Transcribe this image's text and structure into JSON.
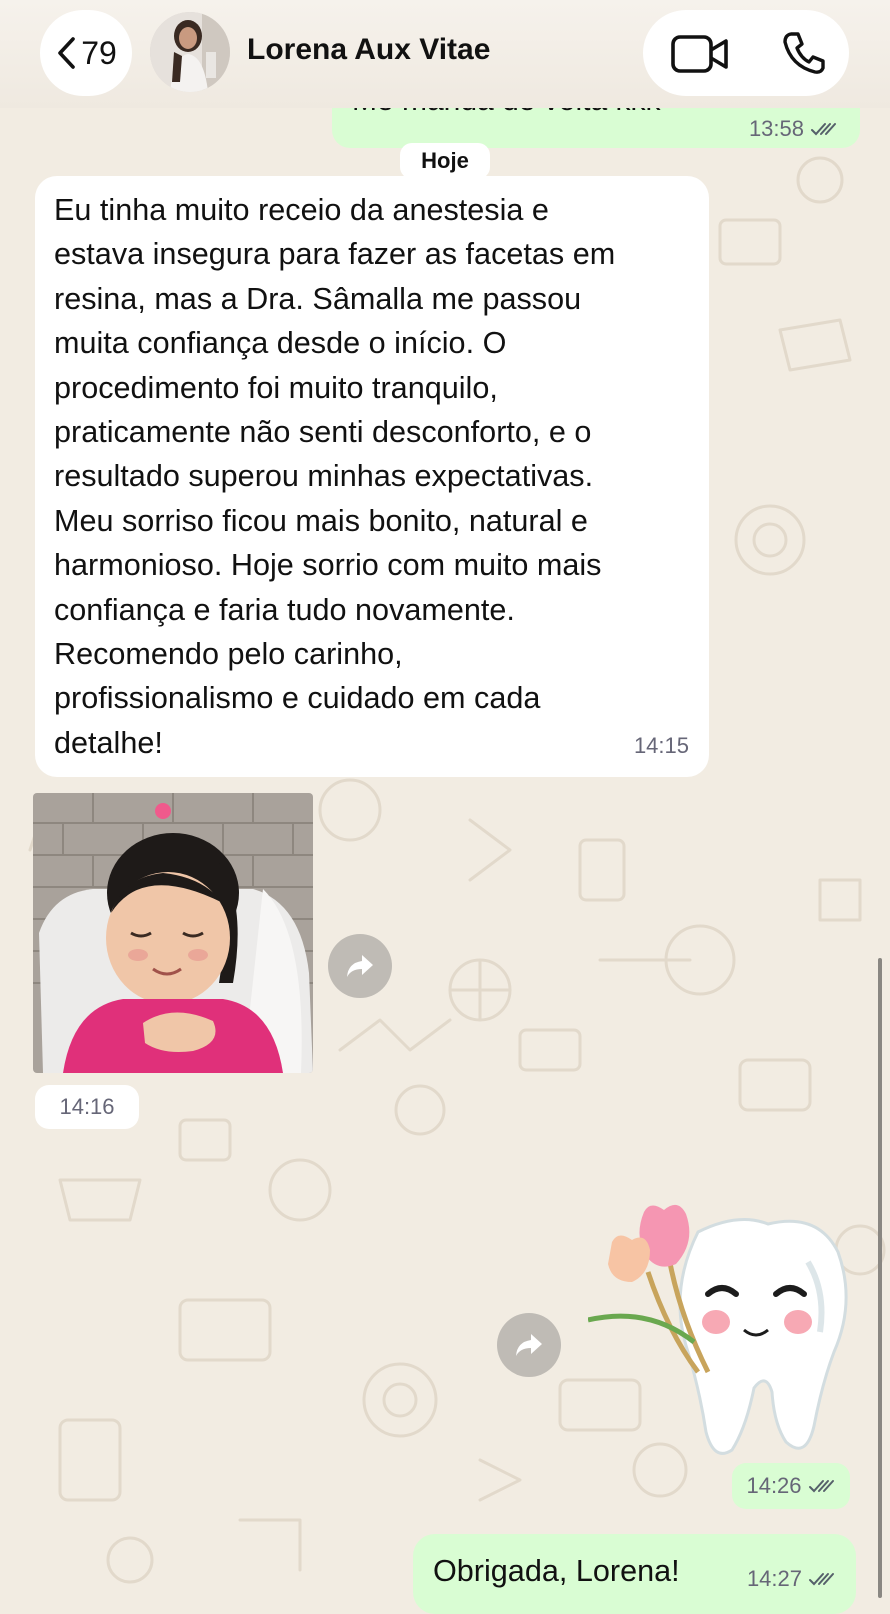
{
  "header": {
    "back_count": "79",
    "contact_name": "Lorena Aux Vitae",
    "icons": [
      "chevron-left-icon",
      "video-call-icon",
      "phone-icon"
    ]
  },
  "messages": {
    "previous_outgoing": {
      "text_partial": "Me manda de volta kkk",
      "time": "13:58"
    },
    "date_separator": "Hoje",
    "testimonial": {
      "text": "Eu tinha muito receio da anestesia e\nestava insegura para fazer as facetas em\nresina, mas a Dra. Sâmalla me passou\nmuita confiança desde o início. O\nprocedimento foi muito tranquilo,\npraticamente não senti desconforto, e o\nresultado superou minhas expectativas.\nMeu sorriso ficou mais bonito, natural e\nharmonioso. Hoje sorrio com muito mais\nconfiança e faria tudo novamente.\nRecomendo pelo carinho,\nprofissionalismo e cuidado em cada\ndetalhe!",
      "time": "14:15"
    },
    "photo": {
      "time": "14:16"
    },
    "sticker": {
      "time": "14:26"
    },
    "last_outgoing": {
      "text": "Obrigada, Lorena!",
      "time": "14:27"
    }
  },
  "colors": {
    "outgoing_bubble": "#d9fdd3",
    "incoming_bubble": "#ffffff",
    "chat_background": "#f2ece2",
    "read_ticks": "#55606a"
  }
}
